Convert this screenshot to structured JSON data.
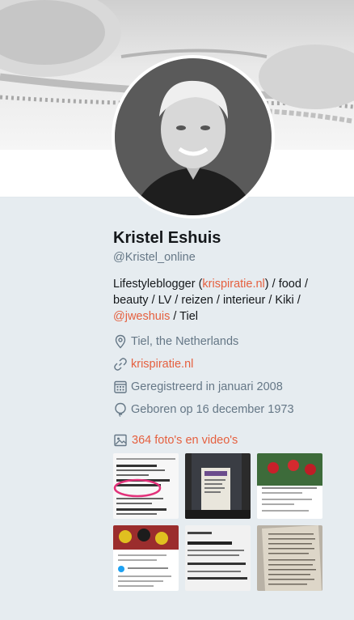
{
  "profile": {
    "name": "Kristel Eshuis",
    "handle": "@Kristel_online",
    "bio": {
      "part1": "Lifestyleblogger (",
      "link1": "krispiratie.nl",
      "part2": ") / food / beauty / LV / reizen / interieur / Kiki / ",
      "link2": "@jweshuis",
      "part3": " / Tiel"
    },
    "location": "Tiel, the Netherlands",
    "website": "krispiratie.nl",
    "joined": "Geregistreerd in januari 2008",
    "birthday": "Geboren op 16 december 1973"
  },
  "media": {
    "label": "364 foto's en video's",
    "thumbnails": [
      {
        "id": "thumb-1",
        "kind": "newspaper-clipping"
      },
      {
        "id": "thumb-2",
        "kind": "document-on-cabinet"
      },
      {
        "id": "thumb-3",
        "kind": "tweet-football"
      },
      {
        "id": "thumb-4",
        "kind": "tweet-football-crowd"
      },
      {
        "id": "thumb-5",
        "kind": "mailbox-schedule"
      },
      {
        "id": "thumb-6",
        "kind": "book-page"
      }
    ]
  },
  "colors": {
    "accent": "#e5603f",
    "secondary_text": "#657786",
    "background": "#e6ecf0"
  },
  "icons": [
    "location-icon",
    "link-icon",
    "calendar-icon",
    "balloon-icon",
    "photo-icon"
  ]
}
